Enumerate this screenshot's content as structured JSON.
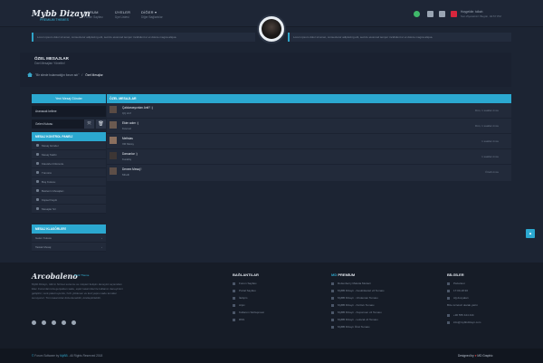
{
  "header": {
    "logo": "Mybb Dizayn",
    "logo_sub": "PREMIUM THEMES",
    "nav": [
      {
        "label": "FORUM",
        "sub": "Forum Sayfası"
      },
      {
        "label": "ÜYELER",
        "sub": "Üye Listesi"
      },
      {
        "label": "DİĞER ▾",
        "sub": "Diğer Bağlantılar"
      }
    ],
    "user_name": "Hoşgeldin: tolkah",
    "user_desc": "Son Ziyaretiniz: Bugün, 04:57 PM"
  },
  "announcements": {
    "left": "Lorem ipsum dolor sit amet, consectetur adipiscing elit, sed do eiusmod tempor incididunt ut et dolore magna aliqua.",
    "right": "Lorem ipsum dolor sit amet, consectetur adipiscing elit, sed do eiusmod tempor incididunt ut et dolore magna aliqua."
  },
  "page": {
    "title": "ÖZEL MESAJLAR",
    "subtitle": "Özel Mesajları Yöneltin!",
    "breadcrumb": [
      "\"Bir sitede bulamadığın forum adı\"",
      "Özel Mesajlar"
    ]
  },
  "sidebar": {
    "new_message": "Yeni Mesaj Gönder",
    "search_value": "Aranacak kelime",
    "folder_select": "Gelen Kutusu",
    "panel_title": "MESAJ KONTROL PANELİ",
    "panel_items": [
      "Mesaj Gönder",
      "Mesaj Takibi",
      "Klasörleri Düzenle",
      "Tümünü",
      "Boş Kutusu",
      "Beklenin Mesajları",
      "Kişisel Kaydı",
      "Mesajlar Sil"
    ],
    "folders_title": "MESAJ KLASÖRLERİ",
    "folder_items": [
      "Gelen Kutusu",
      "Taslak Mesaj"
    ]
  },
  "messages": {
    "header": "ÖZEL MESAJLAR",
    "rows": [
      {
        "subject": "Çakılarasyonları Anti? :)",
        "from": "ÇÇ Arıf",
        "time": "Dün, 1 saatlar önce"
      },
      {
        "subject": "Ekim adım :)",
        "from": "Kovnuz",
        "time": "Dün, 1 saatlar önce"
      },
      {
        "subject": "Mefistas",
        "from": "XR Mutsy",
        "time": "1 saatlar önce"
      },
      {
        "subject": "Darsanlar :)",
        "from": "Kurallış",
        "time": "1 saatlar önce"
      },
      {
        "subject": "Denem Mesaj !",
        "from": "Mirelli",
        "time": "Özelli önce"
      }
    ]
  },
  "footer": {
    "logo": "Arcobaleno",
    "badge": "Dark Theme",
    "text": "Mybb Dizayn, türk'ın hizmet sunumu ve müşteri iletişim deneyimi açısından lider. Forumlarınıza gerçekten sade, eşsiz tasarımlar ile kullanıcı deneyimini geliştirin; renk paleti uyumlu, hızlı yüklenen ve kod yapısı sade temalar sunuyoruz. Tüm tasarımlar düzenlenebilir, özelleştirilebilir.",
    "col1_title": "BAĞLANTILAR",
    "col1_links": [
      "Forum Sayfası",
      "Portal Sayfası",
      "İletişim",
      "Arşiv",
      "Kullanım Sözleşmesi",
      "RSS"
    ],
    "col2_title_accent": "MD",
    "col2_title": "PREMİUM",
    "col2_links": [
      "Rottenberry Malutia Modern",
      "MyBB Dizayn - Keskinkaraz v2 Teması",
      "MyBB Dizayn - Vindeman Teması",
      "MyBB Dizayn - Kırıltıcı Teması",
      "MyBB Dizayn - Kuponxen v2 Teması",
      "MyBB Dizayn - Lolocal v2 Teması",
      "MyBB Dizayn Özel Teması"
    ],
    "col3_title": "BİLGİLER",
    "col3_links": [
      "Pazartesi",
      "17:00-18:30",
      "Ağ dosyaları",
      "Bize ücretsiz olarak yazın"
    ],
    "col3_phone": "+90 555 444 444",
    "col3_email": "info@mybbdizayn.com"
  },
  "bottom": {
    "copy_a": "Forum Software by",
    "copy_b": "MyBB",
    "copy_c": "- All Rights Reserved 2018",
    "designed_a": "Designed by",
    "designed_b": "MD Graphic"
  },
  "colors": {
    "accent": "#2ba8d0",
    "background": "#1c2433"
  }
}
